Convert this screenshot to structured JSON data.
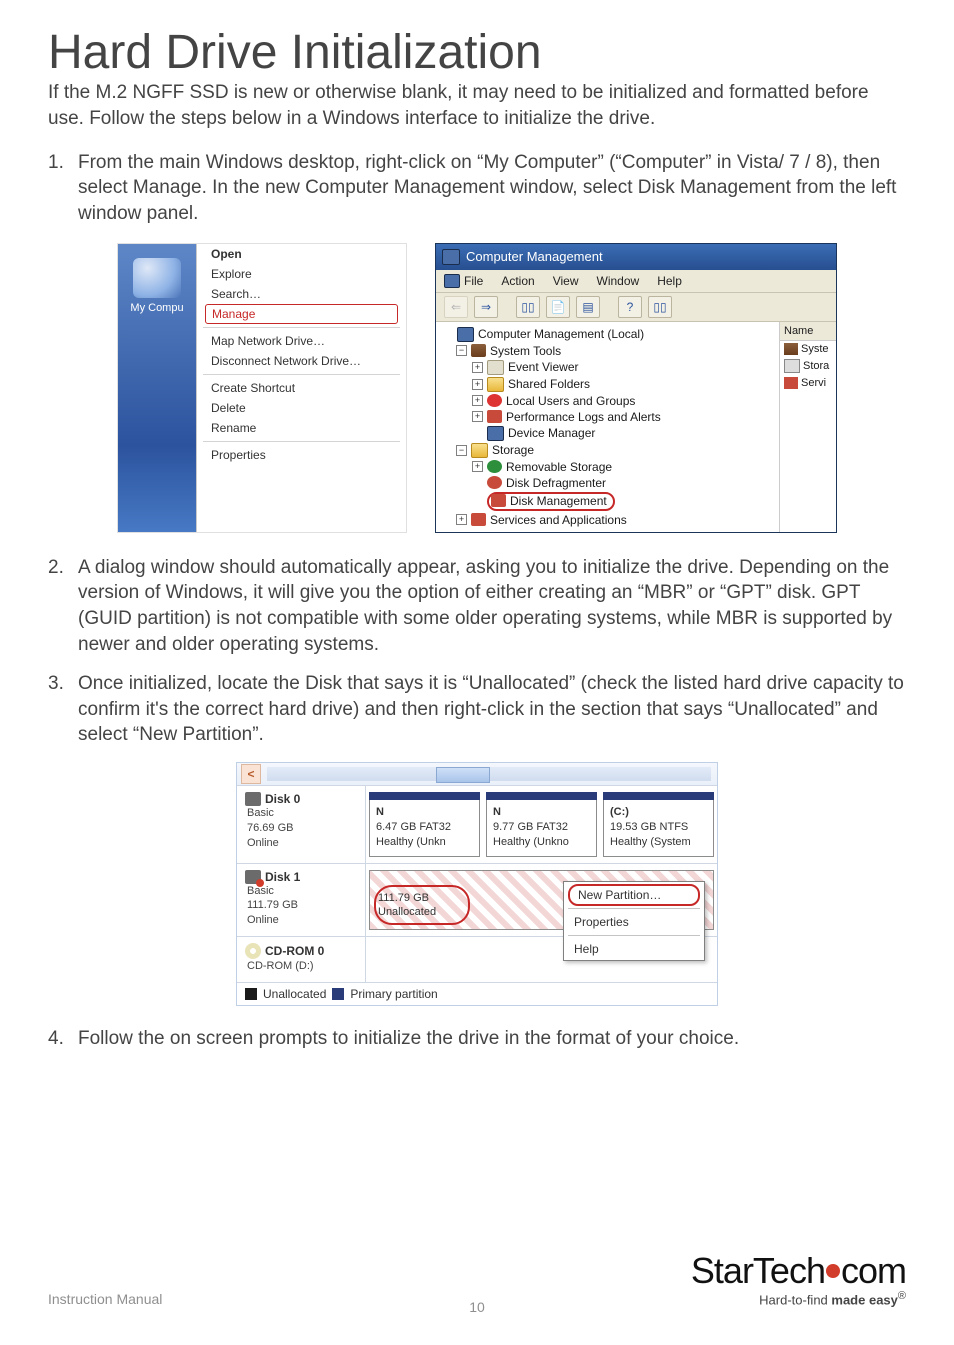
{
  "title": "Hard Drive Initialization",
  "intro": "If the M.2 NGFF SSD is new or otherwise blank, it may need to be initialized and formatted before use.  Follow the steps below in a Windows interface to initialize the drive.",
  "steps": [
    {
      "num": "1.",
      "text": "From the main Windows desktop, right-click on “My Computer” (“Computer” in Vista/ 7 / 8), then select Manage. In the new Computer Management window, select Disk Management from the left window panel."
    },
    {
      "num": "2.",
      "text": "A dialog window should automatically appear, asking you to initialize the drive. Depending on the version of Windows, it will give you the option of either creating an “MBR” or “GPT” disk. GPT (GUID partition) is not compatible with some older operating systems, while MBR is supported by newer and older operating systems."
    },
    {
      "num": "3.",
      "text": "Once initialized, locate the Disk that says it is “Unallocated” (check the listed hard drive capacity to confirm it's the correct hard drive) and then right-click in the section that says “Unallocated” and select “New Partition”."
    },
    {
      "num": "4.",
      "text": "Follow the on screen prompts to initialize the drive in the format of your choice."
    }
  ],
  "figA": {
    "icon_label": "My Compu",
    "items": [
      "Open",
      "Explore",
      "Search…",
      "Manage",
      "Map Network Drive…",
      "Disconnect Network Drive…",
      "Create Shortcut",
      "Delete",
      "Rename",
      "Properties"
    ]
  },
  "figB": {
    "title": "Computer Management",
    "menus": [
      "File",
      "Action",
      "View",
      "Window",
      "Help"
    ],
    "tree": {
      "root": "Computer Management (Local)",
      "sys": "System Tools",
      "ev": "Event Viewer",
      "sf": "Shared Folders",
      "lu": "Local Users and Groups",
      "pl": "Performance Logs and Alerts",
      "dm": "Device Manager",
      "st": "Storage",
      "rs": "Removable Storage",
      "dd": "Disk Defragmenter",
      "dmg": "Disk Management",
      "sa": "Services and Applications"
    },
    "side": {
      "head": "Name",
      "r1": "Syste",
      "r2": "Stora",
      "r3": "Servi"
    }
  },
  "figC": {
    "disk0": {
      "name": "Disk 0",
      "type": "Basic",
      "size": "76.69 GB",
      "state": "Online",
      "p1": {
        "l1": "N",
        "l2": "6.47 GB FAT32",
        "l3": "Healthy (Unkn"
      },
      "p2": {
        "l1": "N",
        "l2": "9.77 GB FAT32",
        "l3": "Healthy (Unkno"
      },
      "p3": {
        "l1": "(C:)",
        "l2": "19.53 GB NTFS",
        "l3": "Healthy (System"
      }
    },
    "disk1": {
      "name": "Disk 1",
      "type": "Basic",
      "size": "111.79 GB",
      "state": "Online",
      "un": {
        "l1": "111.79 GB",
        "l2": "Unallocated"
      }
    },
    "cd": {
      "name": "CD-ROM 0",
      "sub": "CD-ROM (D:)"
    },
    "ctx": {
      "np": "New Partition…",
      "prop": "Properties",
      "help": "Help"
    },
    "legend": {
      "un": "Unallocated",
      "pp": "Primary partition"
    }
  },
  "footer": {
    "im": "Instruction Manual",
    "page": "10"
  },
  "logo": {
    "brand_a": "StarTech",
    "brand_b": "com",
    "tag_a": "Hard-to-find ",
    "tag_b": "made easy",
    "reg": "®"
  }
}
